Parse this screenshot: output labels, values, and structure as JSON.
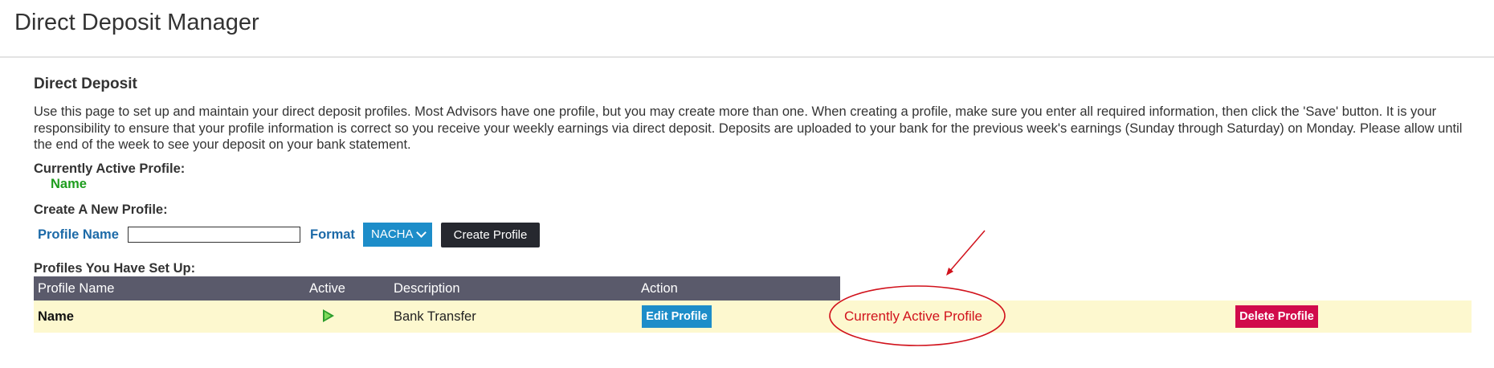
{
  "page": {
    "title": "Direct Deposit Manager"
  },
  "section": {
    "title": "Direct Deposit",
    "intro": "Use this page to set up and maintain your direct deposit profiles. Most Advisors have one profile, but you may create more than one. When creating a profile, make sure you enter all required information, then click the 'Save' button.  It is your responsibility to ensure that your profile information is correct so you receive your weekly earnings via direct deposit. Deposits are uploaded to your bank for the previous week's earnings (Sunday through Saturday) on Monday. Please allow until the end of the week to see your deposit on your bank statement."
  },
  "active_profile": {
    "label": "Currently Active Profile:",
    "name": "Name"
  },
  "create": {
    "heading": "Create A New Profile:",
    "profile_name_label": "Profile Name",
    "profile_name_value": "",
    "format_label": "Format",
    "format_selected": "NACHA",
    "create_button": "Create Profile"
  },
  "profiles": {
    "heading": "Profiles You Have Set Up:",
    "columns": [
      "Profile Name",
      "Active",
      "Description",
      "Action"
    ],
    "rows": [
      {
        "name": "Name",
        "active_icon": "play-icon",
        "description": "Bank Transfer",
        "edit_label": "Edit Profile",
        "status_text": "Currently Active Profile",
        "delete_label": "Delete Profile"
      }
    ]
  },
  "colors": {
    "header_bg": "#5a5a6b",
    "row_bg": "#fdf8cf",
    "primary_blue": "#1d8dc9",
    "danger_red": "#d10b4b",
    "annotation_red": "#d1121c",
    "active_green": "#1e9d1e",
    "label_blue": "#1c6aa8"
  }
}
